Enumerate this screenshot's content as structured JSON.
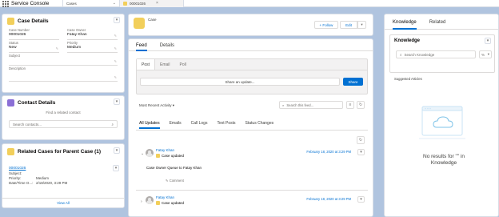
{
  "app": {
    "name": "Service Console",
    "nav_select": "Cases"
  },
  "tabs": [
    {
      "label": "00001026"
    }
  ],
  "case_details": {
    "title": "Case Details",
    "fields": [
      {
        "label": "Case Number",
        "value": "00001026"
      },
      {
        "label": "Case Owner",
        "value": "Fatay Khan"
      },
      {
        "label": "Status",
        "value": "New"
      },
      {
        "label": "Priority",
        "value": "Medium"
      },
      {
        "label": "Subject",
        "value": ""
      },
      {
        "label": "Description",
        "value": ""
      }
    ]
  },
  "contact_details": {
    "title": "Contact Details",
    "empty_text": "Find a related contact",
    "search_placeholder": "Search contacts..."
  },
  "related_cases": {
    "title": "Related Cases for Parent Case (1)",
    "case_number": "00001026",
    "rows": [
      {
        "label": "Subject:",
        "value": ""
      },
      {
        "label": "Priority:",
        "value": "Medium"
      },
      {
        "label": "Date/Time O...:",
        "value": "2/18/2020, 3:29 PM"
      }
    ],
    "view_all": "View All"
  },
  "header": {
    "object_label": "Case",
    "follow_label": "+ Follow",
    "edit_label": "Edit"
  },
  "feed": {
    "tabs": [
      "Feed",
      "Details"
    ],
    "publisher_tabs": [
      "Post",
      "Email",
      "Poll"
    ],
    "share_placeholder": "Share an update...",
    "share_button": "Share",
    "sort_label": "Most Recent Activity",
    "search_placeholder": "Search this feed...",
    "filters": [
      "All Updates",
      "Emails",
      "Call Logs",
      "Text Posts",
      "Status Changes"
    ],
    "posts": [
      {
        "author": "Fatay Khan",
        "status": "Case updated",
        "timestamp": "February 18, 2020 at 3:29 PM",
        "body": "Case Owner Queue to Fatay Khan",
        "comment_label": "Comment"
      },
      {
        "author": "Fatay Khan",
        "status": "Case updated",
        "timestamp": "February 18, 2020 at 3:29 PM",
        "body": "",
        "comment_label": ""
      }
    ]
  },
  "knowledge": {
    "tabs": [
      "Knowledge",
      "Related"
    ],
    "title": "Knowledge",
    "search_placeholder": "Search Knowledge",
    "suggested_label": "Suggested Articles",
    "no_results": "No results for \"\" in Knowledge"
  },
  "colors": {
    "brand": "#0070d2",
    "case_icon": "#f2cf5b",
    "contact_icon": "#8b6fd6",
    "background": "#b0c4df"
  }
}
